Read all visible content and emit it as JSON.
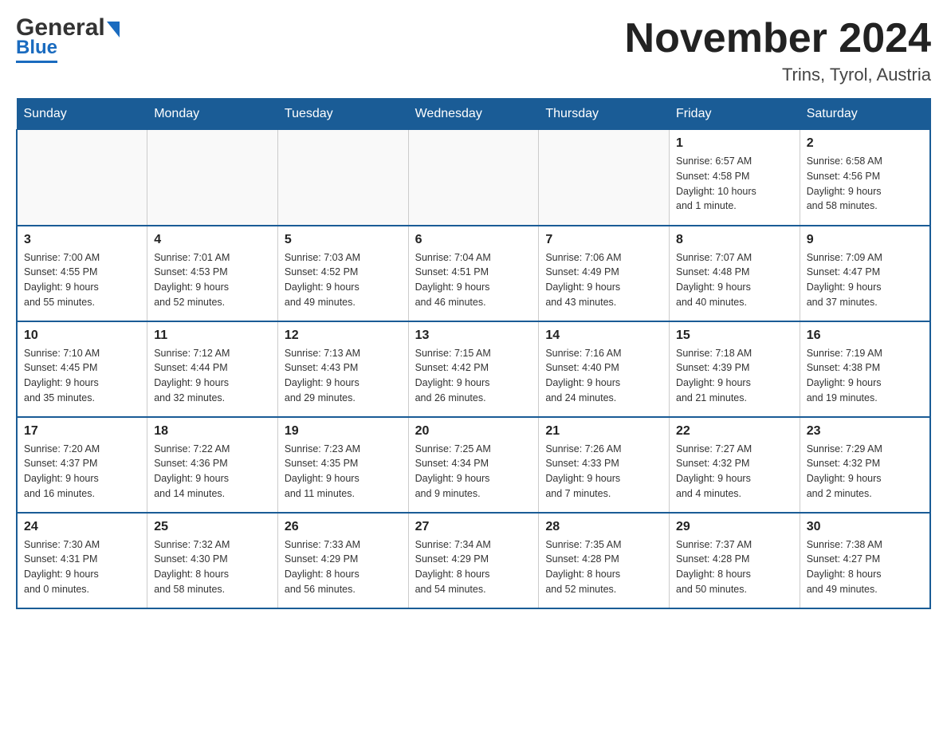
{
  "header": {
    "logo_general": "General",
    "logo_blue": "Blue",
    "month_title": "November 2024",
    "location": "Trins, Tyrol, Austria"
  },
  "days_of_week": [
    "Sunday",
    "Monday",
    "Tuesday",
    "Wednesday",
    "Thursday",
    "Friday",
    "Saturday"
  ],
  "weeks": [
    {
      "cells": [
        {
          "day": "",
          "info": ""
        },
        {
          "day": "",
          "info": ""
        },
        {
          "day": "",
          "info": ""
        },
        {
          "day": "",
          "info": ""
        },
        {
          "day": "",
          "info": ""
        },
        {
          "day": "1",
          "info": "Sunrise: 6:57 AM\nSunset: 4:58 PM\nDaylight: 10 hours\nand 1 minute."
        },
        {
          "day": "2",
          "info": "Sunrise: 6:58 AM\nSunset: 4:56 PM\nDaylight: 9 hours\nand 58 minutes."
        }
      ]
    },
    {
      "cells": [
        {
          "day": "3",
          "info": "Sunrise: 7:00 AM\nSunset: 4:55 PM\nDaylight: 9 hours\nand 55 minutes."
        },
        {
          "day": "4",
          "info": "Sunrise: 7:01 AM\nSunset: 4:53 PM\nDaylight: 9 hours\nand 52 minutes."
        },
        {
          "day": "5",
          "info": "Sunrise: 7:03 AM\nSunset: 4:52 PM\nDaylight: 9 hours\nand 49 minutes."
        },
        {
          "day": "6",
          "info": "Sunrise: 7:04 AM\nSunset: 4:51 PM\nDaylight: 9 hours\nand 46 minutes."
        },
        {
          "day": "7",
          "info": "Sunrise: 7:06 AM\nSunset: 4:49 PM\nDaylight: 9 hours\nand 43 minutes."
        },
        {
          "day": "8",
          "info": "Sunrise: 7:07 AM\nSunset: 4:48 PM\nDaylight: 9 hours\nand 40 minutes."
        },
        {
          "day": "9",
          "info": "Sunrise: 7:09 AM\nSunset: 4:47 PM\nDaylight: 9 hours\nand 37 minutes."
        }
      ]
    },
    {
      "cells": [
        {
          "day": "10",
          "info": "Sunrise: 7:10 AM\nSunset: 4:45 PM\nDaylight: 9 hours\nand 35 minutes."
        },
        {
          "day": "11",
          "info": "Sunrise: 7:12 AM\nSunset: 4:44 PM\nDaylight: 9 hours\nand 32 minutes."
        },
        {
          "day": "12",
          "info": "Sunrise: 7:13 AM\nSunset: 4:43 PM\nDaylight: 9 hours\nand 29 minutes."
        },
        {
          "day": "13",
          "info": "Sunrise: 7:15 AM\nSunset: 4:42 PM\nDaylight: 9 hours\nand 26 minutes."
        },
        {
          "day": "14",
          "info": "Sunrise: 7:16 AM\nSunset: 4:40 PM\nDaylight: 9 hours\nand 24 minutes."
        },
        {
          "day": "15",
          "info": "Sunrise: 7:18 AM\nSunset: 4:39 PM\nDaylight: 9 hours\nand 21 minutes."
        },
        {
          "day": "16",
          "info": "Sunrise: 7:19 AM\nSunset: 4:38 PM\nDaylight: 9 hours\nand 19 minutes."
        }
      ]
    },
    {
      "cells": [
        {
          "day": "17",
          "info": "Sunrise: 7:20 AM\nSunset: 4:37 PM\nDaylight: 9 hours\nand 16 minutes."
        },
        {
          "day": "18",
          "info": "Sunrise: 7:22 AM\nSunset: 4:36 PM\nDaylight: 9 hours\nand 14 minutes."
        },
        {
          "day": "19",
          "info": "Sunrise: 7:23 AM\nSunset: 4:35 PM\nDaylight: 9 hours\nand 11 minutes."
        },
        {
          "day": "20",
          "info": "Sunrise: 7:25 AM\nSunset: 4:34 PM\nDaylight: 9 hours\nand 9 minutes."
        },
        {
          "day": "21",
          "info": "Sunrise: 7:26 AM\nSunset: 4:33 PM\nDaylight: 9 hours\nand 7 minutes."
        },
        {
          "day": "22",
          "info": "Sunrise: 7:27 AM\nSunset: 4:32 PM\nDaylight: 9 hours\nand 4 minutes."
        },
        {
          "day": "23",
          "info": "Sunrise: 7:29 AM\nSunset: 4:32 PM\nDaylight: 9 hours\nand 2 minutes."
        }
      ]
    },
    {
      "cells": [
        {
          "day": "24",
          "info": "Sunrise: 7:30 AM\nSunset: 4:31 PM\nDaylight: 9 hours\nand 0 minutes."
        },
        {
          "day": "25",
          "info": "Sunrise: 7:32 AM\nSunset: 4:30 PM\nDaylight: 8 hours\nand 58 minutes."
        },
        {
          "day": "26",
          "info": "Sunrise: 7:33 AM\nSunset: 4:29 PM\nDaylight: 8 hours\nand 56 minutes."
        },
        {
          "day": "27",
          "info": "Sunrise: 7:34 AM\nSunset: 4:29 PM\nDaylight: 8 hours\nand 54 minutes."
        },
        {
          "day": "28",
          "info": "Sunrise: 7:35 AM\nSunset: 4:28 PM\nDaylight: 8 hours\nand 52 minutes."
        },
        {
          "day": "29",
          "info": "Sunrise: 7:37 AM\nSunset: 4:28 PM\nDaylight: 8 hours\nand 50 minutes."
        },
        {
          "day": "30",
          "info": "Sunrise: 7:38 AM\nSunset: 4:27 PM\nDaylight: 8 hours\nand 49 minutes."
        }
      ]
    }
  ]
}
